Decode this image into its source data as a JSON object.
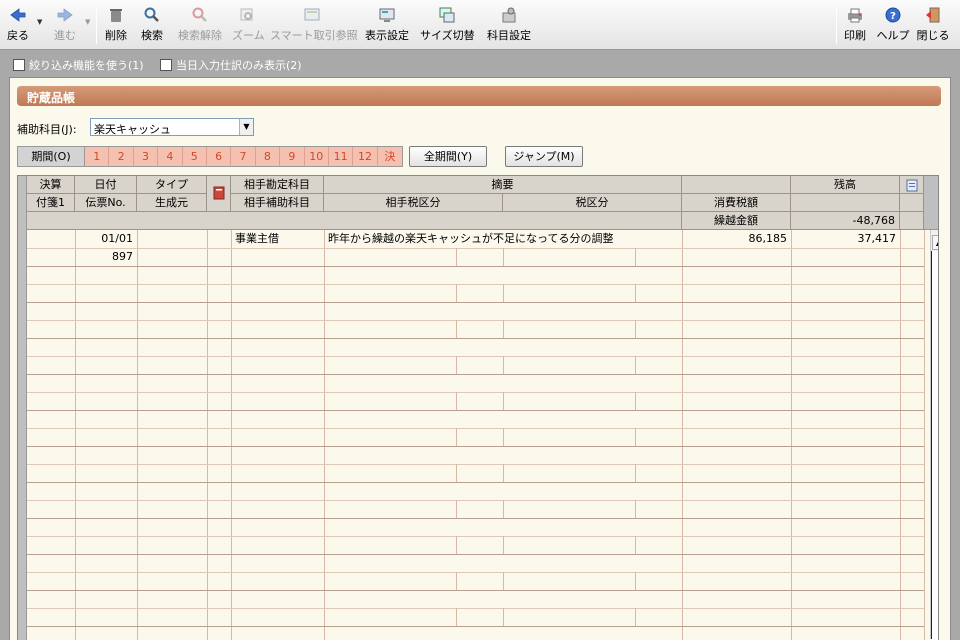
{
  "toolbar": {
    "back": "戻る",
    "forward": "進む",
    "delete": "削除",
    "search": "検索",
    "clear_search": "検索解除",
    "zoom": "ズーム",
    "smart_ref": "スマート取引参照",
    "display_settings": "表示設定",
    "size_switch": "サイズ切替",
    "account_settings": "科目設定",
    "print": "印刷",
    "help": "ヘルプ",
    "close": "閉じる"
  },
  "options": {
    "filter": "絞り込み機能を使う(1)",
    "today_only": "当日入力仕訳のみ表示(2)"
  },
  "panel": {
    "title": "貯蔵品帳",
    "sub_account_label": "補助科目(J):",
    "sub_account_value": "楽天キャッシュ",
    "period_label": "期間(O)",
    "months": [
      "1",
      "2",
      "3",
      "4",
      "5",
      "6",
      "7",
      "8",
      "9",
      "10",
      "11",
      "12",
      "決"
    ],
    "all_period_button": "全期間(Y)",
    "jump_button": "ジャンプ(M)"
  },
  "grid": {
    "headers": {
      "settle": "決算",
      "slip1": "付箋1",
      "date": "日付",
      "voucher_no": "伝票No.",
      "type": "タイプ",
      "origin": "生成元",
      "counter_account": "相手勘定科目",
      "counter_sub": "相手補助科目",
      "summary": "摘要",
      "counter_tax": "相手税区分",
      "tax": "税区分",
      "consumption_tax": "消費税額",
      "carryover": "繰越金額",
      "balance": "残高"
    },
    "carryover_balance": "-48,768",
    "rows": [
      {
        "date": "01/01",
        "voucher_no": "897",
        "counter_account": "事業主借",
        "summary": "昨年から繰越の楽天キャッシュが不足になってる分の調整",
        "amount": "86,185",
        "balance": "37,417"
      }
    ]
  },
  "colors": {
    "title_bar": "#c98462",
    "panel_bg": "#fbf8ec",
    "month_bg": "#f4c1b0",
    "month_text": "#d1492b"
  }
}
